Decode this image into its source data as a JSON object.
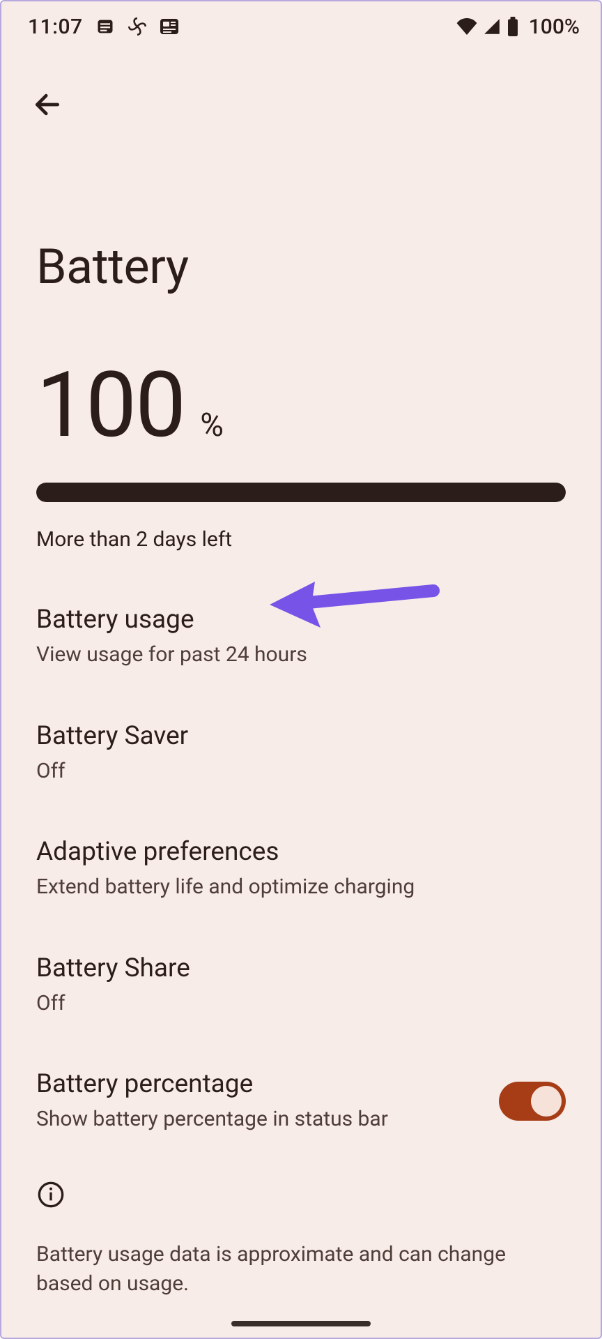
{
  "statusbar": {
    "time": "11:07",
    "battery_pct": "100%"
  },
  "page": {
    "title": "Battery"
  },
  "hero": {
    "value": "100",
    "unit": "%",
    "fill_pct": 100,
    "subtext": "More than 2 days left"
  },
  "rows": {
    "usage": {
      "title": "Battery usage",
      "sub": "View usage for past 24 hours"
    },
    "saver": {
      "title": "Battery Saver",
      "sub": "Off"
    },
    "adaptive": {
      "title": "Adaptive preferences",
      "sub": "Extend battery life and optimize charging"
    },
    "share": {
      "title": "Battery Share",
      "sub": "Off"
    },
    "percentage": {
      "title": "Battery percentage",
      "sub": "Show battery percentage in status bar",
      "toggle_on": true
    }
  },
  "footer": {
    "text": "Battery usage data is approximate and can change based on usage."
  }
}
